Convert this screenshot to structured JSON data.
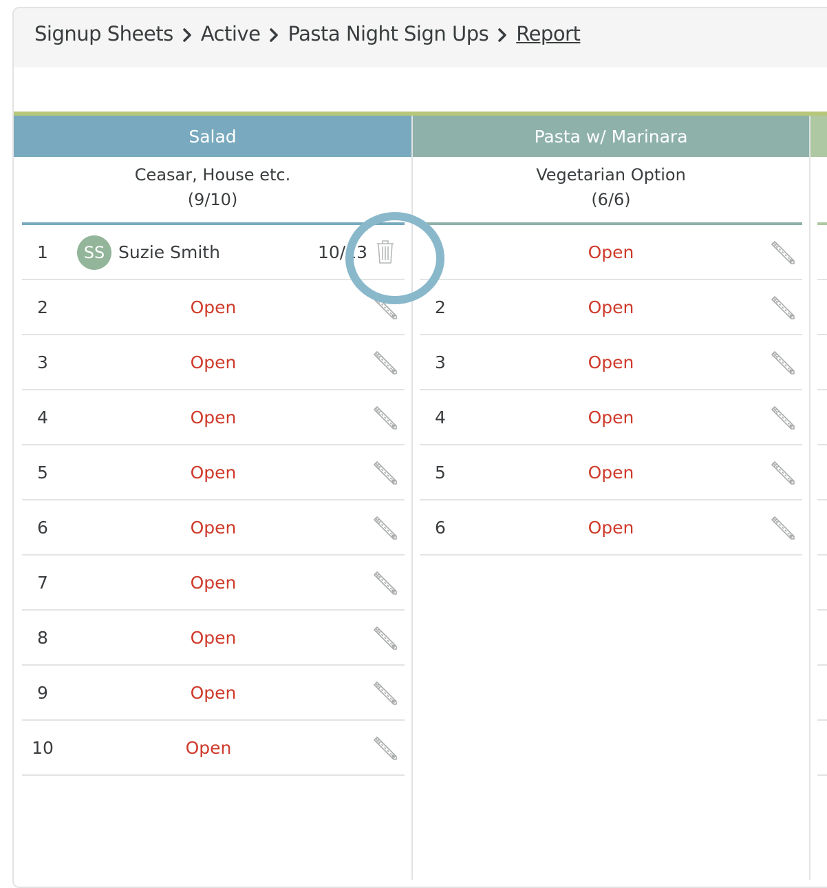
{
  "breadcrumb": [
    "Signup Sheets",
    "Active",
    "Pasta Night Sign Ups",
    "Report"
  ],
  "colors": {
    "salad_header": "#79a9be",
    "pasta_header": "#8eb1aa",
    "top_accent": "#b6c779",
    "open_text": "#cf3a2a",
    "avatar": "#93b59a",
    "highlight_ring": "#8ab8cb"
  },
  "columns": [
    {
      "title": "Salad",
      "subtitle": "Ceasar, House etc.",
      "count": "(9/10)",
      "slots": [
        {
          "num": "1",
          "filled": true,
          "initials": "SS",
          "name": "Suzie Smith",
          "date": "10/13"
        },
        {
          "num": "2",
          "status": "Open"
        },
        {
          "num": "3",
          "status": "Open"
        },
        {
          "num": "4",
          "status": "Open"
        },
        {
          "num": "5",
          "status": "Open"
        },
        {
          "num": "6",
          "status": "Open"
        },
        {
          "num": "7",
          "status": "Open"
        },
        {
          "num": "8",
          "status": "Open"
        },
        {
          "num": "9",
          "status": "Open"
        },
        {
          "num": "10",
          "status": "Open"
        }
      ]
    },
    {
      "title": "Pasta w/ Marinara",
      "subtitle": "Vegetarian Option",
      "count": "(6/6)",
      "slots": [
        {
          "num": "1",
          "status": "Open"
        },
        {
          "num": "2",
          "status": "Open"
        },
        {
          "num": "3",
          "status": "Open"
        },
        {
          "num": "4",
          "status": "Open"
        },
        {
          "num": "5",
          "status": "Open"
        },
        {
          "num": "6",
          "status": "Open"
        }
      ]
    }
  ]
}
